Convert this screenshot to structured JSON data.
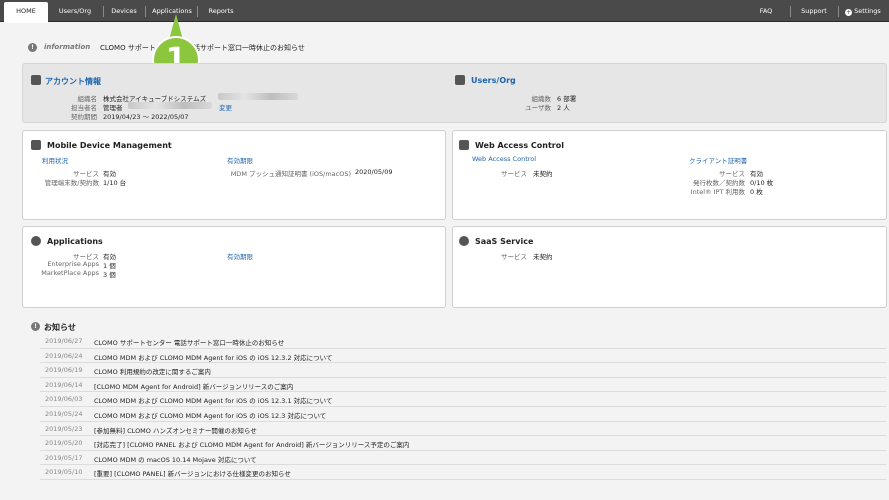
{
  "nav": {
    "tabs": [
      {
        "label": "HOME",
        "active": true
      },
      {
        "label": "Users/Org"
      },
      {
        "label": "Devices"
      },
      {
        "label": "Applications"
      },
      {
        "label": "Reports"
      }
    ],
    "right": {
      "faq": "FAQ",
      "support": "Support",
      "settings": "Settings"
    }
  },
  "info": {
    "label": "information",
    "text": "CLOMO サポートセンター 電話サポート窓口一時休止のお知らせ"
  },
  "callout": {
    "number": "1"
  },
  "account": {
    "title": "アカウント情報",
    "rows": [
      {
        "key": "組織名",
        "value": "株式会社アイキューブドシステムズ"
      },
      {
        "key": "担当者名",
        "value": "管理者",
        "link": "変更"
      },
      {
        "key": "契約期間",
        "value": "2019/04/23 〜 2022/05/07"
      }
    ]
  },
  "users_org": {
    "title": "Users/Org",
    "rows": [
      {
        "key": "組織数",
        "value": "6 部署"
      },
      {
        "key": "ユーザ数",
        "value": "2 人"
      }
    ]
  },
  "mdm": {
    "title": "Mobile Device Management",
    "usage_link": "利用状況",
    "rows": [
      {
        "key": "サービス",
        "value": "有効"
      },
      {
        "key": "管理端末数/契約数",
        "value": "1/10 台"
      }
    ],
    "expiry_link": "有効期限",
    "cert": {
      "key": "MDM プッシュ通知証明書 (iOS/macOS)",
      "value": "2020/05/09"
    }
  },
  "wac": {
    "title": "Web Access Control",
    "link": "Web Access Control",
    "service": {
      "key": "サービス",
      "value": "未契約"
    },
    "client_link": "クライアント証明書",
    "client_rows": [
      {
        "key": "サービス",
        "value": "有効"
      },
      {
        "key": "発行枚数／契約数",
        "value": "0/10 枚"
      },
      {
        "key": "Intel® IPT 利用数",
        "value": "0 枚"
      }
    ]
  },
  "apps": {
    "title": "Applications",
    "rows": [
      {
        "key": "サービス",
        "value": "有効"
      },
      {
        "key": "Enterprise Apps",
        "value": "1 個"
      },
      {
        "key": "MarketPlace Apps",
        "value": "3 個"
      }
    ],
    "expiry_link": "有効期限"
  },
  "saas": {
    "title": "SaaS Service",
    "service": {
      "key": "サービス",
      "value": "未契約"
    }
  },
  "news": {
    "title": "お知らせ",
    "items": [
      {
        "date": "2019/06/27",
        "text": "CLOMO サポートセンター 電話サポート窓口一時休止のお知らせ"
      },
      {
        "date": "2019/06/24",
        "text": "CLOMO MDM および CLOMO MDM Agent for iOS の iOS 12.3.2 対応について"
      },
      {
        "date": "2019/06/19",
        "text": "CLOMO 利用規約の改定に関するご案内"
      },
      {
        "date": "2019/06/14",
        "text": "[CLOMO MDM Agent for Android] 新バージョンリリースのご案内"
      },
      {
        "date": "2019/06/03",
        "text": "CLOMO MDM および CLOMO MDM Agent for iOS の iOS 12.3.1 対応について"
      },
      {
        "date": "2019/05/24",
        "text": "CLOMO MDM および CLOMO MDM Agent for iOS の iOS 12.3 対応について"
      },
      {
        "date": "2019/05/23",
        "text": "[参加無料] CLOMO ハンズオンセミナー開催のお知らせ"
      },
      {
        "date": "2019/05/20",
        "text": "[対応完了] [CLOMO PANEL および CLOMO MDM Agent for Android] 新バージョンリリース予定のご案内"
      },
      {
        "date": "2019/05/17",
        "text": "CLOMO MDM の macOS 10.14 Mojave 対応について"
      },
      {
        "date": "2019/05/10",
        "text": "[重要] [CLOMO PANEL] 新バージョンにおける仕様変更のお知らせ"
      }
    ]
  }
}
